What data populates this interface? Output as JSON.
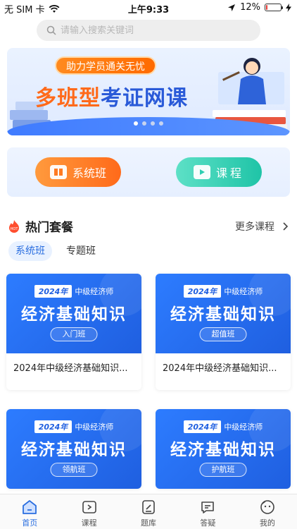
{
  "status_bar": {
    "carrier": "无 SIM 卡",
    "time": "上午9:33",
    "battery_percent": "12%",
    "battery_level": 0.12,
    "battery_color": "#e53935"
  },
  "search": {
    "placeholder": "请输入搜索关键词",
    "icon": "search-icon"
  },
  "banner": {
    "tag": "助力学员通关无忧",
    "title_part1": "多班型",
    "title_part2": "考证网课",
    "dots_count": 4,
    "active_dot": 0
  },
  "class_types": [
    {
      "label": "系统班",
      "icon": "book-icon",
      "color": "#ff7a22"
    },
    {
      "label": "课程",
      "icon": "play-icon",
      "color": "#2ccfb2"
    }
  ],
  "hot": {
    "title": "热门套餐",
    "icon": "hot-icon",
    "more_label": "更多课程",
    "tabs": [
      "系统班",
      "专题班"
    ],
    "active_tab": 0
  },
  "courses": [
    {
      "year": "2024年",
      "exam": "中级经济师",
      "cover_title": "经济基础知识",
      "badge": "入门班",
      "name": "2024年中级经济基础知识..."
    },
    {
      "year": "2024年",
      "exam": "中级经济师",
      "cover_title": "经济基础知识",
      "badge": "超值班",
      "name": "2024年中级经济基础知识..."
    },
    {
      "year": "2024年",
      "exam": "中级经济师",
      "cover_title": "经济基础知识",
      "badge": "领航班",
      "name": ""
    },
    {
      "year": "2024年",
      "exam": "中级经济师",
      "cover_title": "经济基础知识",
      "badge": "护航班",
      "name": ""
    }
  ],
  "tabbar": {
    "items": [
      {
        "label": "首页",
        "icon": "home-icon"
      },
      {
        "label": "课程",
        "icon": "course-icon"
      },
      {
        "label": "题库",
        "icon": "question-bank-icon"
      },
      {
        "label": "答疑",
        "icon": "qa-icon"
      },
      {
        "label": "我的",
        "icon": "profile-icon"
      }
    ],
    "active_index": 0,
    "accent": "#2a6ee0"
  }
}
